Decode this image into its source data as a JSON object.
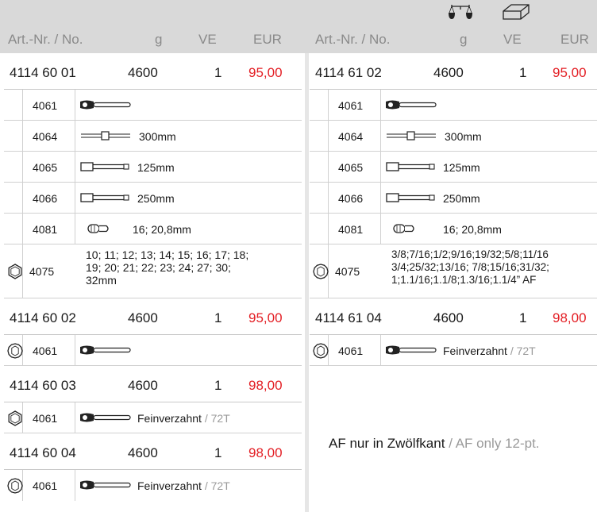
{
  "header": {
    "col1": "Art.-Nr. / No.",
    "col2": "g",
    "col3": "VE",
    "col4": "EUR",
    "icons": [
      "scale-icon",
      "box-icon"
    ]
  },
  "left": {
    "g1": {
      "art": "4114 60 01",
      "g": "4600",
      "ve": "1",
      "eur": "95,00",
      "items": [
        {
          "no": "4061",
          "desc": ""
        },
        {
          "no": "4064",
          "desc": "300mm"
        },
        {
          "no": "4065",
          "desc": "125mm"
        },
        {
          "no": "4066",
          "desc": "250mm"
        },
        {
          "no": "4081",
          "desc": "16; 20,8mm"
        },
        {
          "no": "4075",
          "line1": "10; 11; 12; 13; 14; 15; 16; 17; 18;",
          "line2": "19; 20; 21; 22; 23; 24; 27; 30;",
          "line3": "32mm"
        }
      ]
    },
    "g2": {
      "art": "4114 60 02",
      "g": "4600",
      "ve": "1",
      "eur": "95,00",
      "item": {
        "no": "4061"
      }
    },
    "g3": {
      "art": "4114 60 03",
      "g": "4600",
      "ve": "1",
      "eur": "98,00",
      "item": {
        "no": "4061",
        "desc": "Feinverzahnt",
        "desc_en": "/ 72T"
      }
    },
    "g4": {
      "art": "4114 60 04",
      "g": "4600",
      "ve": "1",
      "eur": "98,00",
      "item": {
        "no": "4061",
        "desc": "Feinverzahnt",
        "desc_en": "/ 72T"
      }
    }
  },
  "right": {
    "g1": {
      "art": "4114 61 02",
      "g": "4600",
      "ve": "1",
      "eur": "95,00",
      "items": [
        {
          "no": "4061",
          "desc": ""
        },
        {
          "no": "4064",
          "desc": "300mm"
        },
        {
          "no": "4065",
          "desc": "125mm"
        },
        {
          "no": "4066",
          "desc": "250mm"
        },
        {
          "no": "4081",
          "desc": "16; 20,8mm"
        },
        {
          "no": "4075",
          "line1": "3/8;7/16;1/2;9/16;19/32;5/8;11/16",
          "line2": "3/4;25/32;13/16; 7/8;15/16;31/32;",
          "line3": "1;1.1/16;1.1/8;1.3/16;1.1/4” AF"
        }
      ]
    },
    "g2": {
      "art": "4114 61 04",
      "g": "4600",
      "ve": "1",
      "eur": "98,00",
      "item": {
        "no": "4061",
        "desc": "Feinverzahnt",
        "desc_en": "/ 72T"
      }
    }
  },
  "note": {
    "de": "AF nur in Zwölfkant",
    "en": "/ AF only 12-pt."
  },
  "colors": {
    "price": "#e31e24",
    "header_bg": "#d9d9d9",
    "muted": "#9a9a9a"
  }
}
